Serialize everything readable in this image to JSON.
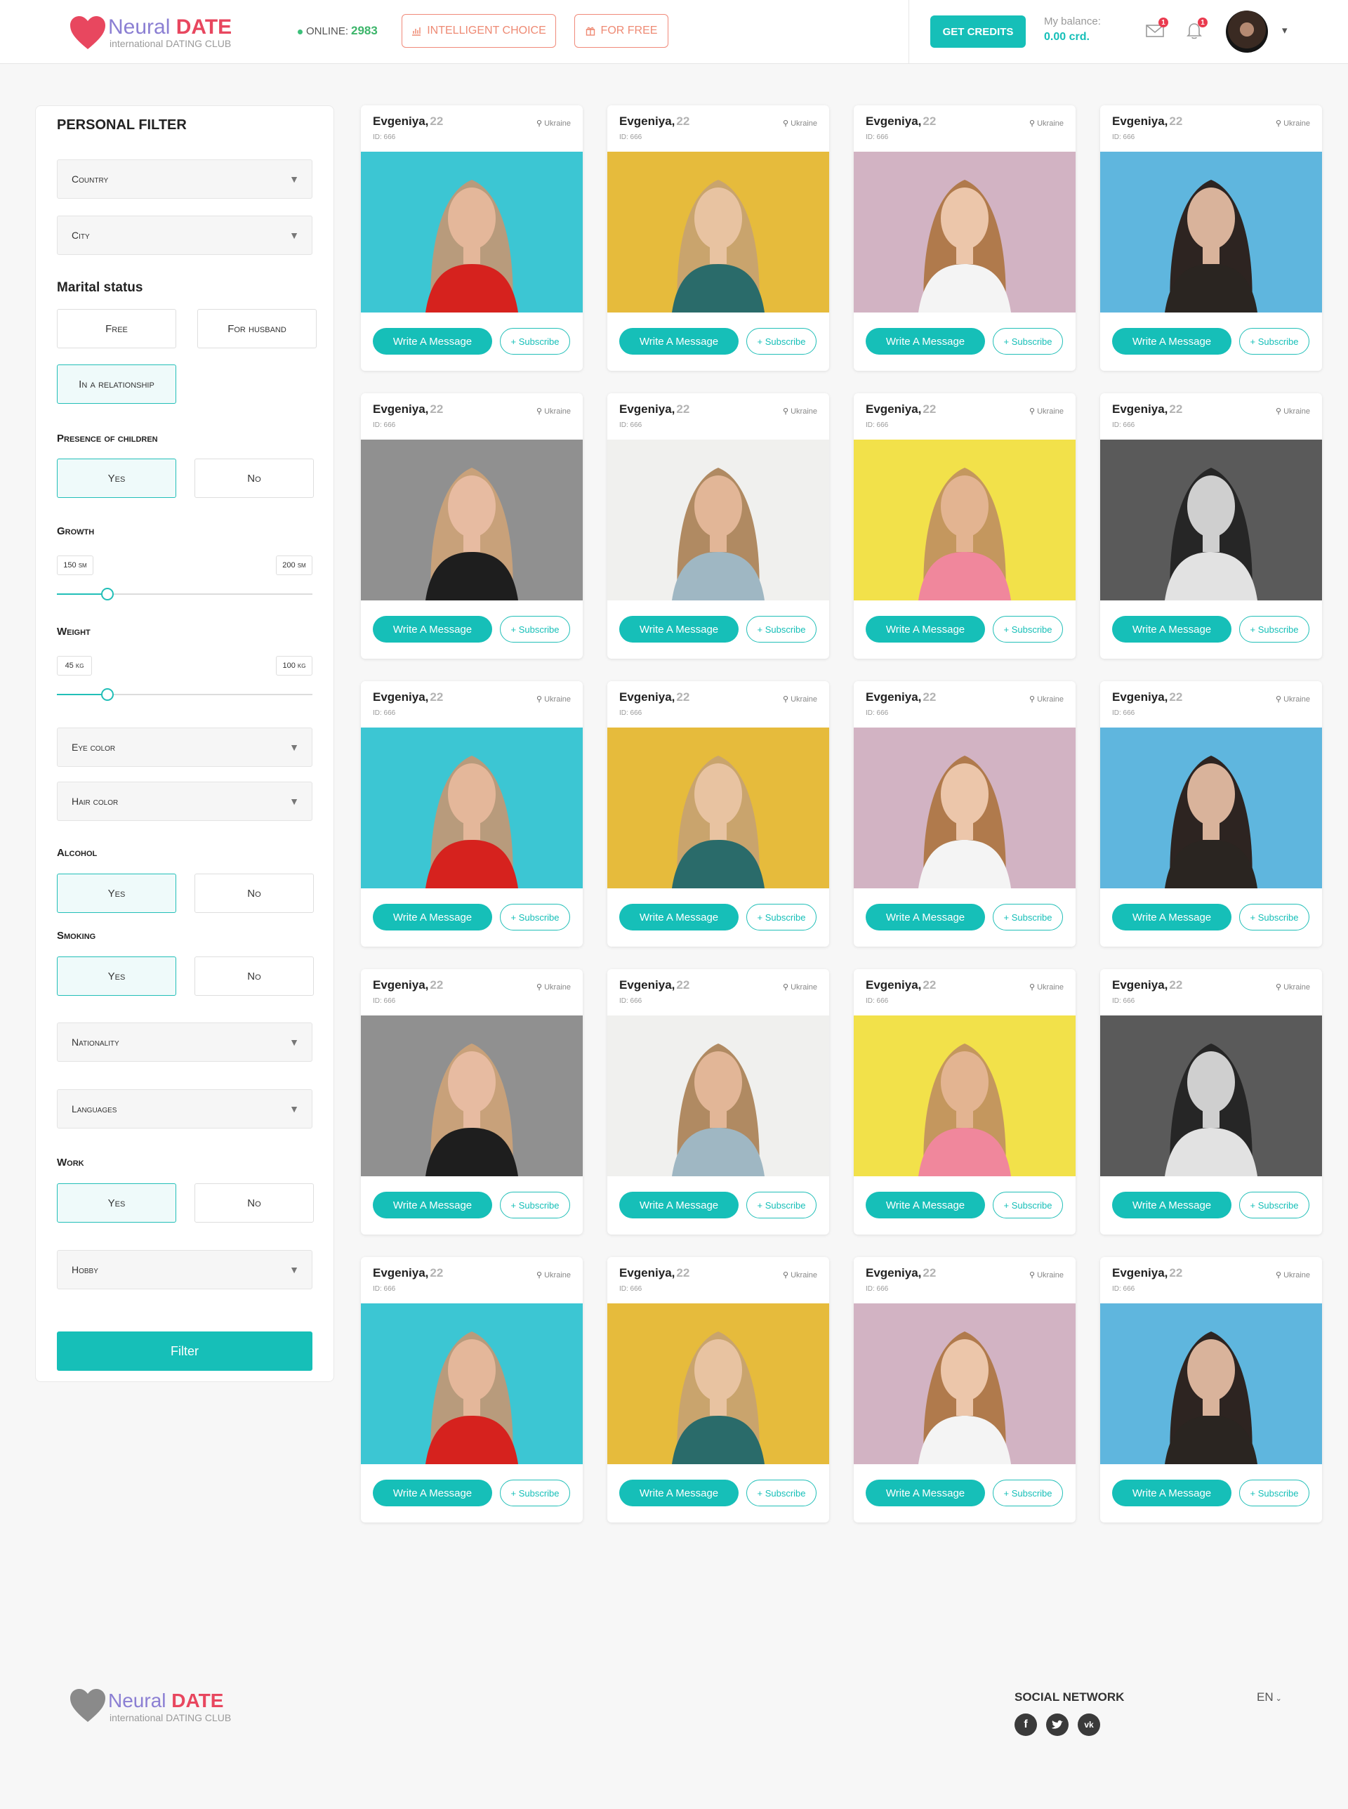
{
  "header": {
    "logo": {
      "name_part1": "Neural",
      "name_part2": "DATE",
      "tagline": "international DATING CLUB"
    },
    "online_label": "ONLINE:",
    "online_count": "2983",
    "intelligent_choice_label": "INTELLIGENT CHOICE",
    "for_free_label": "FOR FREE",
    "get_credits_label": "GET CREDITS",
    "balance_label": "My balance:",
    "balance_value": "0.00 crd.",
    "mail_badge": "1",
    "bell_badge": "1",
    "menu_caret": "▾"
  },
  "filter": {
    "title": "PERSONAL FILTER",
    "country_placeholder": "Country",
    "city_placeholder": "City",
    "marital_label": "Marital status",
    "marital_options": [
      "Free",
      "For husband",
      "In a relationship"
    ],
    "marital_selected": "In a relationship",
    "children_label": "Presence of children",
    "yes_label": "Yes",
    "no_label": "No",
    "growth_label": "Growth",
    "growth_min": "150 sm",
    "growth_max": "200 sm",
    "weight_label": "Weight",
    "weight_min": "45 kg",
    "weight_max": "100 kg",
    "eye_color_placeholder": "Eye color",
    "hair_color_placeholder": "Hair color",
    "alcohol_label": "Alcohol",
    "smoking_label": "Smoking",
    "nationality_placeholder": "Nationality",
    "languages_placeholder": "Languages",
    "work_label": "Work",
    "hobby_placeholder": "Hobby",
    "filter_button": "Filter",
    "select_arrow": "▼"
  },
  "profile_card": {
    "name": "Evgeniya,",
    "age": "22",
    "id": "ID: 666",
    "location": "Ukraine",
    "write_message": "Write A Message",
    "subscribe": "+ Subscribe"
  },
  "colors": {
    "accent": "#16bfb8",
    "brand_pink": "#e8475f",
    "brand_purple": "#8b7fd3",
    "header_button_outline": "#f08a7a"
  },
  "footer": {
    "logo": {
      "name_part1": "Neural",
      "name_part2": "DATE",
      "tagline": "international DATING CLUB"
    },
    "social_title": "SOCIAL NETWORK",
    "social_icons": [
      "facebook-icon",
      "twitter-icon",
      "vk-icon"
    ],
    "language": "EN"
  }
}
